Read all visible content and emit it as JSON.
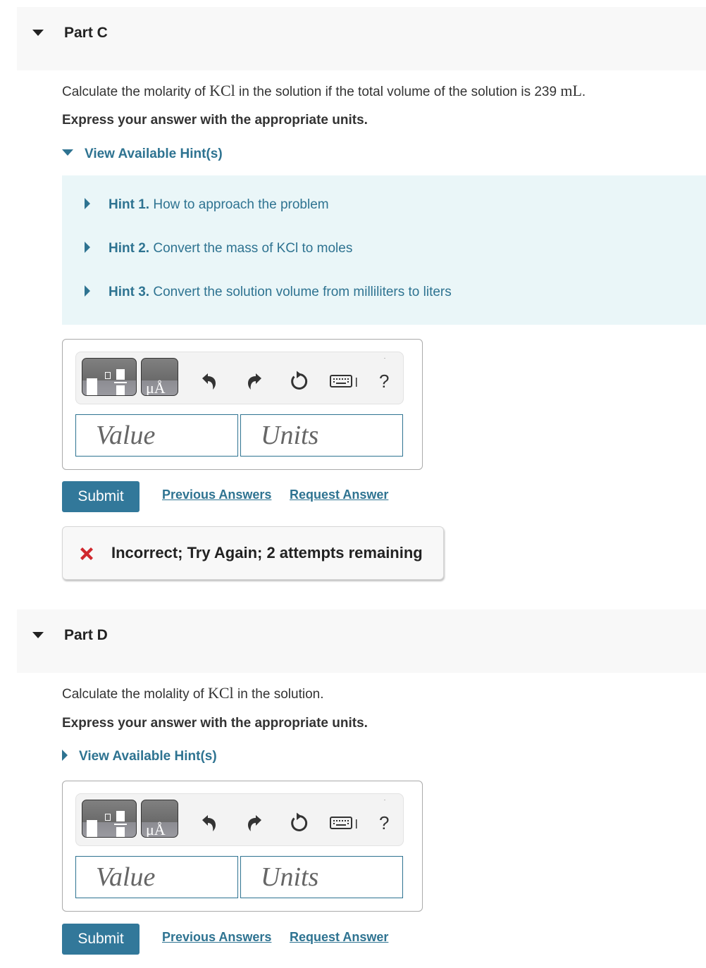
{
  "parts": [
    {
      "title": "Part C",
      "question_prefix": "Calculate the molarity of ",
      "question_formula": "KCl",
      "question_middle": " in the solution if the total volume of the solution is 239 ",
      "question_unit": "mL",
      "question_suffix": ".",
      "instruction": "Express your answer with the appropriate units.",
      "hint_toggle_label": "View Available Hint(s)",
      "hints_expanded": true,
      "hints": [
        {
          "number": "Hint 1.",
          "text": " How to approach the problem"
        },
        {
          "number": "Hint 2.",
          "text": " Convert the mass of KCl to moles"
        },
        {
          "number": "Hint 3.",
          "text": " Convert the solution volume from milliliters to liters"
        }
      ],
      "answer": {
        "value_placeholder": "Value",
        "units_placeholder": "Units",
        "value": "",
        "units": ""
      },
      "toolbar": {
        "templates_icon": "templates-icon",
        "units_icon": "units-icon",
        "units_glyph": "μÅ",
        "undo_icon": "undo-icon",
        "redo_icon": "redo-icon",
        "reset_icon": "reset-icon",
        "keyboard_icon": "keyboard-icon",
        "help_label": "?"
      },
      "submit_label": "Submit",
      "previous_answers_label": "Previous Answers",
      "request_answer_label": "Request Answer",
      "feedback": {
        "icon": "x-icon",
        "status_color": "#d0282e",
        "message": "Incorrect; Try Again; 2 attempts remaining"
      }
    },
    {
      "title": "Part D",
      "question_prefix": "Calculate the molality of ",
      "question_formula": "KCl",
      "question_suffix": " in the solution.",
      "instruction": "Express your answer with the appropriate units.",
      "hint_toggle_label": "View Available Hint(s)",
      "hints_expanded": false,
      "answer": {
        "value_placeholder": "Value",
        "units_placeholder": "Units",
        "value": "",
        "units": ""
      },
      "toolbar": {
        "units_glyph": "μÅ",
        "help_label": "?"
      },
      "submit_label": "Submit",
      "previous_answers_label": "Previous Answers",
      "request_answer_label": "Request Answer"
    }
  ],
  "colors": {
    "accent": "#2e7391",
    "button": "#32789a",
    "hint_background": "#eaf6f8",
    "header_background": "#f8f8f8",
    "error": "#d0282e"
  }
}
